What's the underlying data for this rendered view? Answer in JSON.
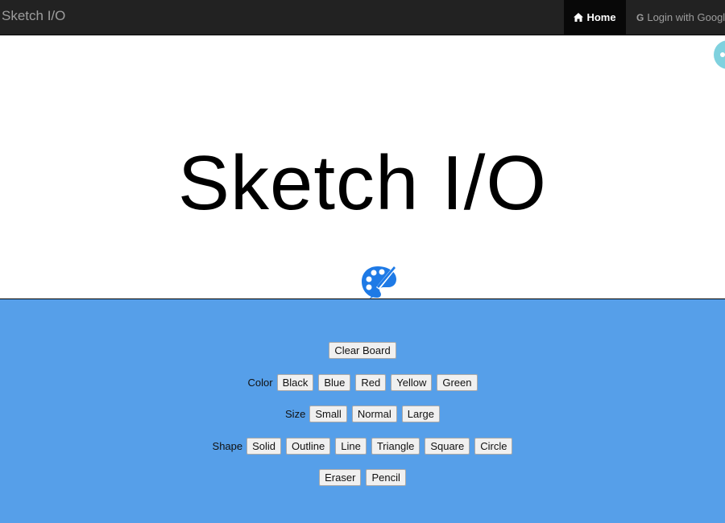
{
  "navbar": {
    "brand": "Sketch I/O",
    "home_label": "Home",
    "login_label": "Login with Google",
    "login_icon_text": "G"
  },
  "hero": {
    "title": "Sketch I/O"
  },
  "toolbar": {
    "clear_label": "Clear Board",
    "color": {
      "label": "Color",
      "options": [
        "Black",
        "Blue",
        "Red",
        "Yellow",
        "Green"
      ]
    },
    "size": {
      "label": "Size",
      "options": [
        "Small",
        "Normal",
        "Large"
      ]
    },
    "shape": {
      "label": "Shape",
      "options": [
        "Solid",
        "Outline",
        "Line",
        "Triangle",
        "Square",
        "Circle"
      ]
    },
    "tools": [
      "Eraser",
      "Pencil"
    ]
  },
  "colors": {
    "navbar_bg": "#222222",
    "board_bg": "#569fe9",
    "icon_blue": "#1e7ae6",
    "float_button": "#7fd1de"
  },
  "icons": {
    "home": "home-icon",
    "login": "google-icon",
    "hero": "palette-brush-icon"
  }
}
